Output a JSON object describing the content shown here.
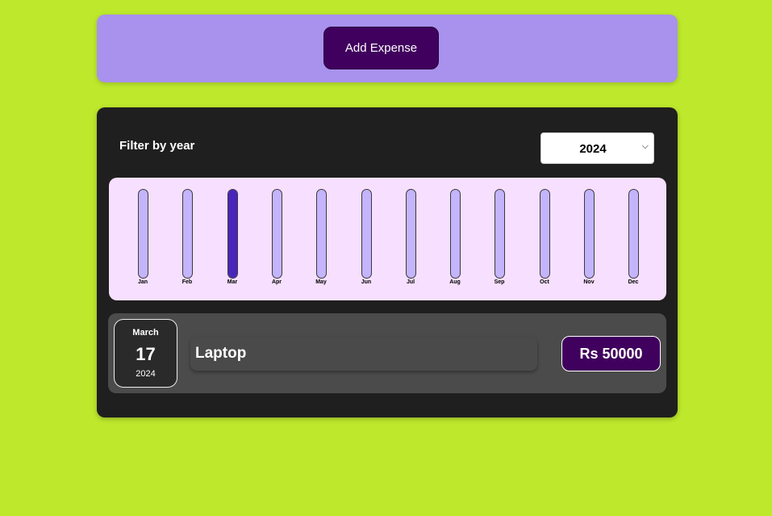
{
  "new_expense": {
    "add_button_label": "Add Expense"
  },
  "filter": {
    "label": "Filter by year",
    "selected_year": "2024"
  },
  "chart_data": {
    "type": "bar",
    "categories": [
      "Jan",
      "Feb",
      "Mar",
      "Apr",
      "May",
      "Jun",
      "Jul",
      "Aug",
      "Sep",
      "Oct",
      "Nov",
      "Dec"
    ],
    "values": [
      0,
      0,
      50000,
      0,
      0,
      0,
      0,
      0,
      0,
      0,
      0,
      0
    ],
    "max_value": 50000,
    "colors": {
      "fill": "#4826b9",
      "empty": "#c3b4fc",
      "background": "#f7dfff"
    }
  },
  "expenses": [
    {
      "month": "March",
      "day": "17",
      "year": "2024",
      "title": "Laptop",
      "amount": "Rs 50000"
    }
  ],
  "colors": {
    "page_background": "#bde82c",
    "top_panel": "#a892ed",
    "button": "#40005d",
    "main_panel": "#1f1f1f",
    "expense_item": "#4b4b4b"
  }
}
